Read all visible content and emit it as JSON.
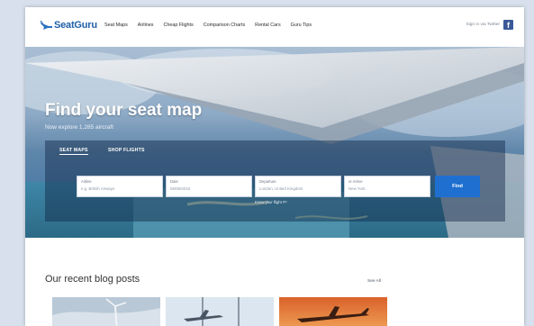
{
  "nav": {
    "brand": "SeatGuru",
    "links": [
      "Seat Maps",
      "Airlines",
      "Cheap Flights",
      "Comparison Charts",
      "Rental Cars",
      "Guru Tips"
    ],
    "signin": "Sign in via Twitter",
    "facebook_glyph": "f"
  },
  "hero": {
    "title": "Find your seat map",
    "subtitle": "Now explore 1,285 aircraft",
    "tabs": [
      "SEAT MAPS",
      "SHOP FLIGHTS"
    ],
    "fields": [
      {
        "label": "Airline",
        "value": "e.g. British Airways"
      },
      {
        "label": "Date",
        "value": "06/08/2018"
      },
      {
        "label": "Departure",
        "value": "London, United Kingdom"
      },
      {
        "label": "or Arrive",
        "value": "New York"
      }
    ],
    "hint": "Know your flight #?",
    "button": "Find"
  },
  "blog": {
    "title": "Our recent blog posts",
    "see_all": "See All"
  },
  "colors": {
    "brand_blue": "#1f5fa8",
    "button_blue": "#1f6fd1",
    "facebook": "#3b5998"
  }
}
